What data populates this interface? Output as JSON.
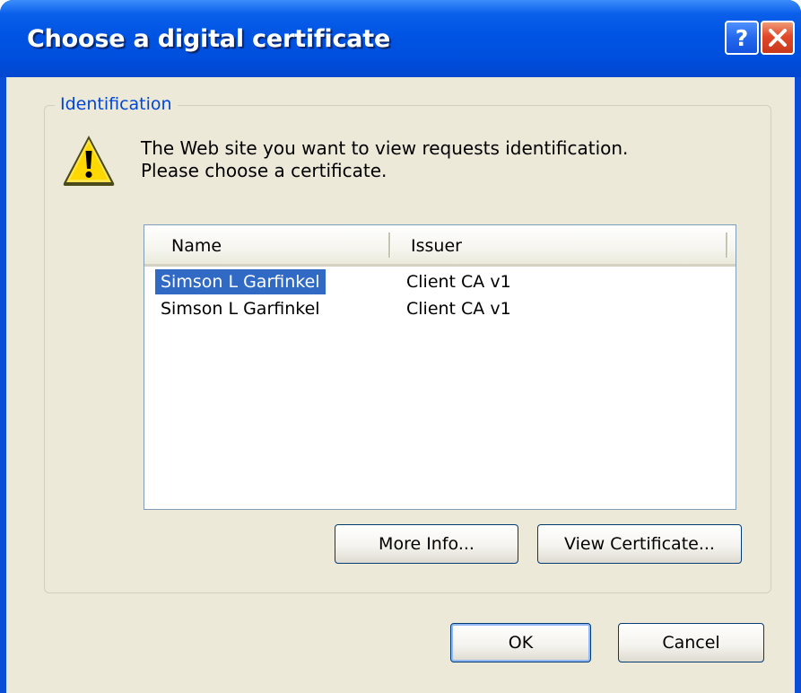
{
  "window": {
    "title": "Choose a digital certificate",
    "help_label": "?",
    "close_label": "✕"
  },
  "group": {
    "legend": "Identification",
    "message": "The Web site you want to view requests identification. Please choose a certificate."
  },
  "table": {
    "columns": [
      "Name",
      "Issuer"
    ],
    "rows": [
      {
        "name": "Simson L Garfinkel",
        "issuer": "Client CA v1",
        "selected": true
      },
      {
        "name": "Simson L Garfinkel",
        "issuer": "Client CA v1",
        "selected": false
      }
    ]
  },
  "buttons": {
    "more_info": "More Info...",
    "view_certificate": "View Certificate...",
    "ok": "OK",
    "cancel": "Cancel"
  },
  "colors": {
    "titlebar": "#0054e3",
    "dialog_face": "#ece9d8",
    "selection": "#316ac5",
    "group_legend": "#0046d5"
  },
  "icons": {
    "warning": "warning-icon",
    "help": "help-icon",
    "close": "close-icon"
  }
}
